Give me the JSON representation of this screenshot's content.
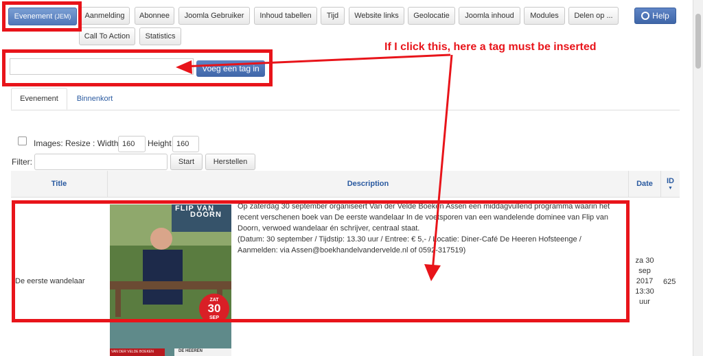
{
  "toolbar": {
    "active_tab": {
      "label": "Evenement",
      "suffix": "(JEM)"
    },
    "buttons": [
      "Aanmelding",
      "Abonnee",
      "Joomla Gebruiker",
      "Inhoud tabellen",
      "Tijd",
      "Website links",
      "Geolocatie",
      "Joomla inhoud",
      "Modules",
      "Delen op ...",
      "Call To Action",
      "Statistics"
    ],
    "help_label": "Help"
  },
  "annotation": {
    "text": "If I click this, here a tag must be inserted"
  },
  "tag_insert": {
    "input_value": "",
    "button_label": "Voeg een tag in"
  },
  "tabs": [
    {
      "label": "Evenement",
      "active": true
    },
    {
      "label": "Binnenkort",
      "active": false
    }
  ],
  "images": {
    "label": "Images: Resize : Width",
    "width_value": "160",
    "height_label": "Height",
    "height_value": "160"
  },
  "filter": {
    "label": "Filter:",
    "value": "",
    "start_label": "Start",
    "reset_label": "Herstellen"
  },
  "table": {
    "columns": [
      "Title",
      "Description",
      "Date",
      "ID"
    ],
    "rows": [
      {
        "title": "De eerste wandelaar",
        "description": [
          "Op zaterdag 30 september organiseert Van der Velde Boeken Assen een middagvullend programma waarin het",
          "recent verschenen boek van De eerste wandelaar In de voetsporen van een wandelende dominee van Flip van",
          "Doorn, verwoed wandelaar én schrijver, centraal staat.",
          "(Datum: 30 september / Tijdstip: 13.30 uur / Entree: € 5,- / Locatie: Diner-Café De Heeren Hofsteenge /",
          "Aanmelden: via Assen@boekhandelvandervelde.nl of 0592-317519)"
        ],
        "date": [
          "za 30",
          "sep",
          "2017",
          "13:30",
          "uur"
        ],
        "id": "625",
        "poster": {
          "author_top": "FLIP VAN",
          "author_bottom": "DOORN",
          "badge_top": "ZAT",
          "badge_day": "30",
          "badge_month": "SEP",
          "store_left": "VAN DER VELDE BOEKEN",
          "store_right": "DE HEEREN"
        }
      }
    ]
  },
  "colors": {
    "annotation_red": "#e8141a",
    "primary_blue": "#4f77b8",
    "link_blue": "#2a5aa0"
  }
}
